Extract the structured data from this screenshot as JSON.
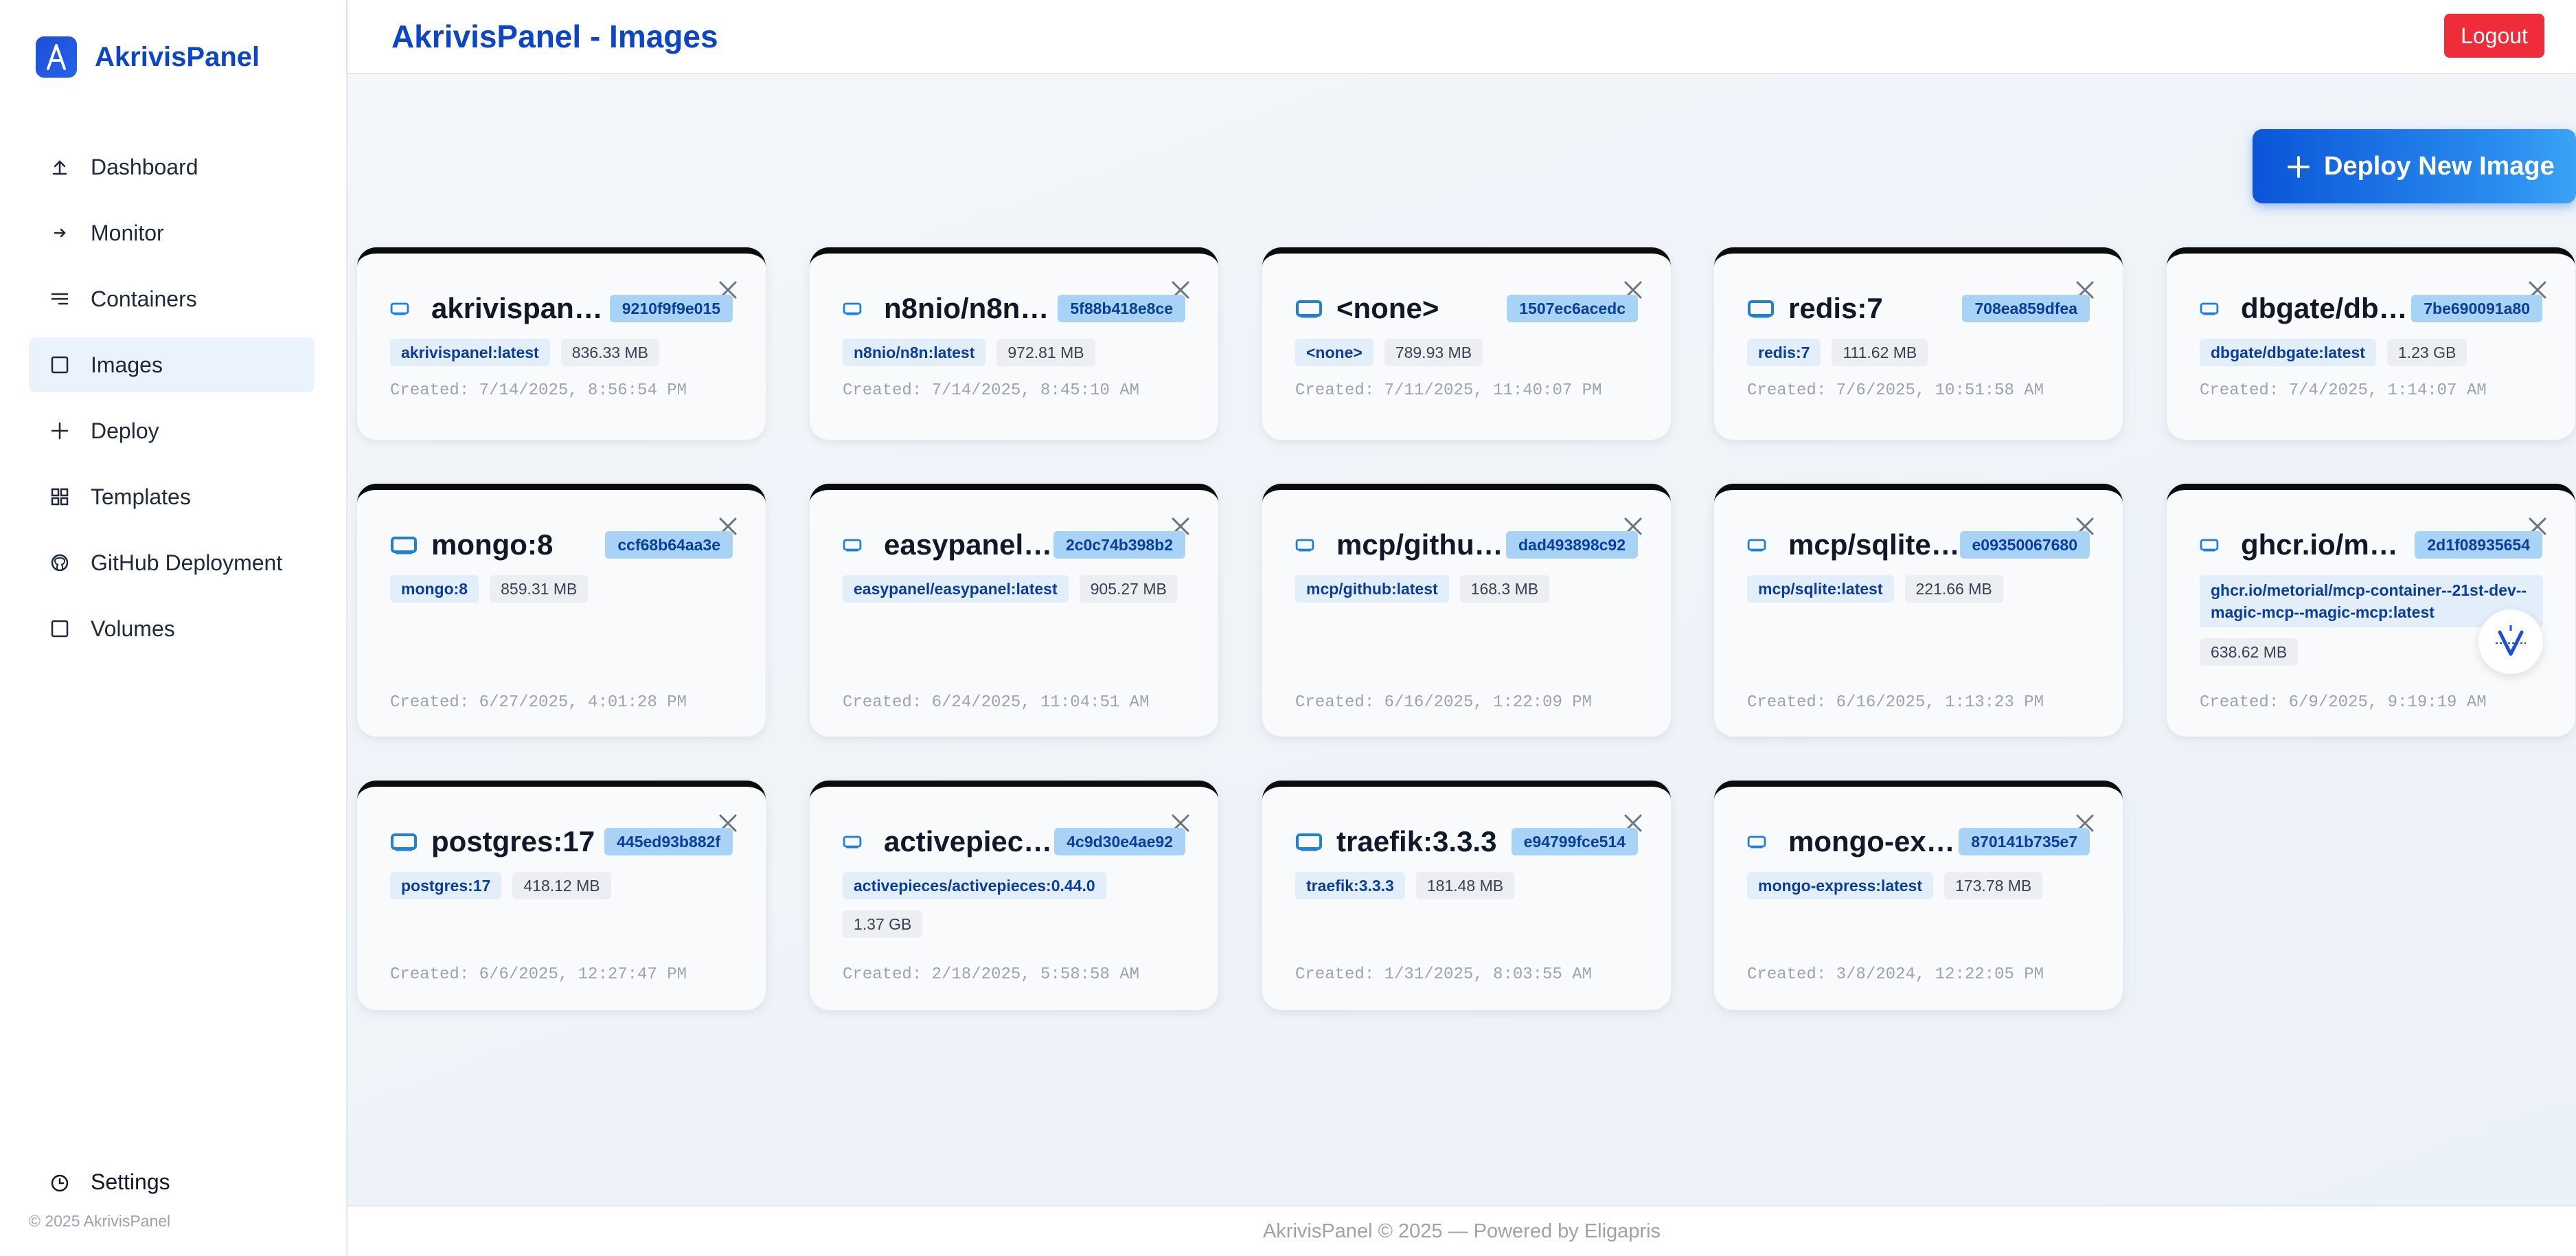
{
  "brand": {
    "name": "AkrivisPanel"
  },
  "sidebar": {
    "items": [
      {
        "label": "Dashboard",
        "icon": "upload-arrow-icon"
      },
      {
        "label": "Monitor",
        "icon": "arrow-right-icon"
      },
      {
        "label": "Containers",
        "icon": "list-icon"
      },
      {
        "label": "Images",
        "icon": "square-icon"
      },
      {
        "label": "Deploy",
        "icon": "plus-icon"
      },
      {
        "label": "Templates",
        "icon": "grid-icon"
      },
      {
        "label": "GitHub Deployment",
        "icon": "github-icon"
      },
      {
        "label": "Volumes",
        "icon": "square-icon"
      }
    ],
    "active": "Images",
    "settings_label": "Settings",
    "copyright": "© 2025 AkrivisPanel"
  },
  "header": {
    "title": "AkrivisPanel - Images",
    "logout_label": "Logout"
  },
  "main": {
    "deploy_label": "Deploy New Image"
  },
  "images": [
    {
      "name": "akrivispanel:latest",
      "id": "9210f9f9e015",
      "tags": [
        "akrivispanel:latest"
      ],
      "size": "836.33 MB",
      "created": "Created: 7/14/2025, 8:56:54 PM"
    },
    {
      "name": "n8nio/n8n:latest",
      "id": "5f88b418e8ce",
      "tags": [
        "n8nio/n8n:latest"
      ],
      "size": "972.81 MB",
      "created": "Created: 7/14/2025, 8:45:10 AM"
    },
    {
      "name": "<none>",
      "id": "1507ec6acedc",
      "tags": [
        "<none>"
      ],
      "size": "789.93 MB",
      "created": "Created: 7/11/2025, 11:40:07 PM"
    },
    {
      "name": "redis:7",
      "id": "708ea859dfea",
      "tags": [
        "redis:7"
      ],
      "size": "111.62 MB",
      "created": "Created: 7/6/2025, 10:51:58 AM"
    },
    {
      "name": "dbgate/dbgate:latest",
      "id": "7be690091a80",
      "tags": [
        "dbgate/dbgate:latest"
      ],
      "size": "1.23 GB",
      "created": "Created: 7/4/2025, 1:14:07 AM"
    },
    {
      "name": "mongo:8",
      "id": "ccf68b64aa3e",
      "tags": [
        "mongo:8"
      ],
      "size": "859.31 MB",
      "created": "Created: 6/27/2025, 4:01:28 PM"
    },
    {
      "name": "easypanel/easypanel:latest",
      "id": "2c0c74b398b2",
      "tags": [
        "easypanel/easypanel:latest"
      ],
      "size": "905.27 MB",
      "created": "Created: 6/24/2025, 11:04:51 AM"
    },
    {
      "name": "mcp/github:latest",
      "id": "dad493898c92",
      "tags": [
        "mcp/github:latest"
      ],
      "size": "168.3 MB",
      "created": "Created: 6/16/2025, 1:22:09 PM"
    },
    {
      "name": "mcp/sqlite:latest",
      "id": "e09350067680",
      "tags": [
        "mcp/sqlite:latest"
      ],
      "size": "221.66 MB",
      "created": "Created: 6/16/2025, 1:13:23 PM"
    },
    {
      "name": "ghcr.io/metorial/mcp-container",
      "id": "2d1f08935654",
      "tags": [
        "ghcr.io/metorial/mcp-container--21st-dev--magic-mcp--magic-mcp:latest"
      ],
      "size": "638.62 MB",
      "created": "Created: 6/9/2025, 9:19:19 AM"
    },
    {
      "name": "postgres:17",
      "id": "445ed93b882f",
      "tags": [
        "postgres:17"
      ],
      "size": "418.12 MB",
      "created": "Created: 6/6/2025, 12:27:47 PM"
    },
    {
      "name": "activepieces/activepieces:0.44.0",
      "id": "4c9d30e4ae92",
      "tags": [
        "activepieces/activepieces:0.44.0"
      ],
      "size": "1.37 GB",
      "created": "Created: 2/18/2025, 5:58:58 AM"
    },
    {
      "name": "traefik:3.3.3",
      "id": "e94799fce514",
      "tags": [
        "traefik:3.3.3"
      ],
      "size": "181.48 MB",
      "created": "Created: 1/31/2025, 8:03:55 AM"
    },
    {
      "name": "mongo-express:latest",
      "id": "870141b735e7",
      "tags": [
        "mongo-express:latest"
      ],
      "size": "173.78 MB",
      "created": "Created: 3/8/2024, 12:22:05 PM"
    }
  ],
  "footer": {
    "text": "AkrivisPanel © 2025 — Powered by Eligapris"
  },
  "colors": {
    "accent": "#0b46c9",
    "logout": "#ef2c3a",
    "badge": "#a9d2f7",
    "tag": "#e3eefb"
  }
}
